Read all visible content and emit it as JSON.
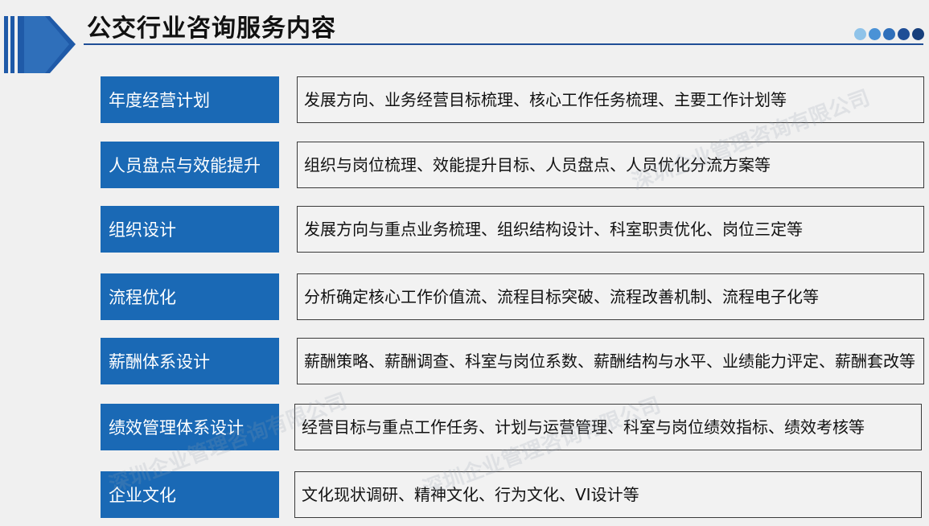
{
  "header": {
    "title": "公交行业咨询服务内容",
    "dot_colors": [
      "#8fc3e9",
      "#4a92d6",
      "#2f6fba",
      "#1f4e96",
      "#173f7c"
    ]
  },
  "rows": [
    {
      "label": "年度经营计划",
      "content": "发展方向、业务经营目标梳理、核心工作任务梳理、主要工作计划等"
    },
    {
      "label": "人员盘点与效能提升",
      "content": "组织与岗位梳理、效能提升目标、人员盘点、人员优化分流方案等"
    },
    {
      "label": "组织设计",
      "content": "发展方向与重点业务梳理、组织结构设计、科室职责优化、岗位三定等"
    },
    {
      "label": "流程优化",
      "content": "分析确定核心工作价值流、流程目标突破、流程改善机制、流程电子化等"
    },
    {
      "label": "薪酬体系设计",
      "content": "薪酬策略、薪酬调查、科室与岗位系数、薪酬结构与水平、业绩能力评定、薪酬套改等"
    },
    {
      "label": "绩效管理体系设计",
      "content": "经营目标与重点工作任务、计划与运营管理、科室与岗位绩效指标、绩效考核等"
    },
    {
      "label": "企业文化",
      "content": "文化现状调研、精神文化、行为文化、VI设计等"
    }
  ],
  "watermark": {
    "text": "深圳企业管理咨询有限公司"
  }
}
